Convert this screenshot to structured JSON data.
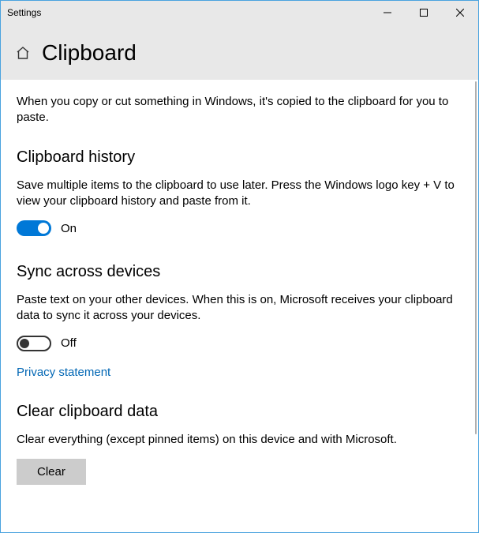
{
  "window": {
    "title": "Settings"
  },
  "header": {
    "page_title": "Clipboard"
  },
  "intro": "When you copy or cut something in Windows, it's copied to the clipboard for you to paste.",
  "sections": {
    "history": {
      "title": "Clipboard history",
      "desc": "Save multiple items to the clipboard to use later. Press the Windows logo key + V to view your clipboard history and paste from it.",
      "toggle_state": "On"
    },
    "sync": {
      "title": "Sync across devices",
      "desc": "Paste text on your other devices. When this is on, Microsoft receives your clipboard data to sync it across your devices.",
      "toggle_state": "Off",
      "privacy_link": "Privacy statement"
    },
    "clear": {
      "title": "Clear clipboard data",
      "desc": "Clear everything (except pinned items) on this device and with Microsoft.",
      "button": "Clear"
    }
  }
}
